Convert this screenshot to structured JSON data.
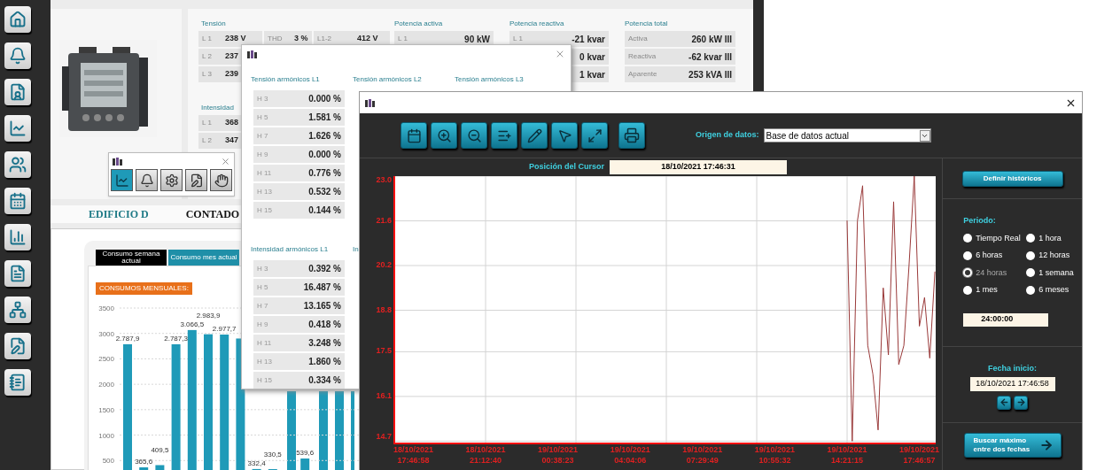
{
  "meter_panel": {
    "tension": {
      "title": "Tensión",
      "rows": [
        [
          {
            "label": "L 1",
            "value": "238 V"
          },
          {
            "label": "THD",
            "value": "3 %"
          },
          {
            "label": "L1-2",
            "value": "412 V"
          }
        ],
        [
          {
            "label": "L 2",
            "value": "237"
          }
        ],
        [
          {
            "label": "L 3",
            "value": "239"
          }
        ]
      ]
    },
    "intensidad": {
      "title": "Intensidad",
      "rows": [
        {
          "label": "L 1",
          "value": "368"
        },
        {
          "label": "L 2",
          "value": "347"
        }
      ]
    },
    "potencia_activa": {
      "title": "Potencia activa",
      "rows": [
        {
          "label": "L 1",
          "value": "90 kW"
        }
      ]
    },
    "potencia_reactiva": {
      "title": "Potencia reactiva",
      "rows": [
        {
          "label": "L 1",
          "value": "-21 kvar"
        },
        {
          "value": "0 kvar"
        },
        {
          "value": "1 kvar"
        }
      ]
    },
    "potencia_total": {
      "title": "Potencia total",
      "rows": [
        {
          "label": "Activa",
          "value": "260 kW III"
        },
        {
          "label": "Reactiva",
          "value": "-62 kvar III"
        },
        {
          "label": "Aparente",
          "value": "253 kVA III"
        }
      ]
    }
  },
  "tool_window": {
    "buttons": [
      {
        "selected": true
      },
      {
        "selected": false
      },
      {
        "selected": false
      },
      {
        "selected": false
      },
      {
        "selected": false
      }
    ]
  },
  "building_bar": {
    "building": "EDIFICIO D",
    "meter": "CONTADO"
  },
  "consumption_card": {
    "tabs": [
      {
        "label": "Consumo semana actual",
        "selected": false
      },
      {
        "label": "Consumo mes actual",
        "selected": true
      }
    ],
    "label": "CONSUMOS MENSUALES:",
    "chart_data": {
      "type": "bar",
      "grid": true,
      "ylim": [
        0,
        3500
      ],
      "yticks": [
        500,
        1000,
        1500,
        2000,
        2500,
        3000,
        3500
      ],
      "values": [
        2787.9,
        365.6,
        409.5,
        2787.3,
        3066.5,
        2983.9,
        2977.7,
        2900,
        332.4,
        330.5,
        null,
        539.6,
        null,
        null,
        null
      ],
      "value_labels": [
        "2.787,9",
        "365,6",
        "409,5",
        "2.787,3",
        "3.066,5",
        "2.983,9",
        "2.977,7",
        null,
        "332,4",
        "330,5",
        null,
        "539,6",
        null,
        null,
        null
      ]
    }
  },
  "harmonics_window": {
    "sections": [
      {
        "columns": [
          {
            "title": "Tensión armónicos L1",
            "rows": [
              {
                "label": "H 3",
                "value": "0.000 %"
              },
              {
                "label": "H 5",
                "value": "1.581 %"
              },
              {
                "label": "H 7",
                "value": "1.626 %"
              },
              {
                "label": "H 9",
                "value": "0.000 %"
              },
              {
                "label": "H 11",
                "value": "0.776 %"
              },
              {
                "label": "H 13",
                "value": "0.532 %"
              },
              {
                "label": "H 15",
                "value": "0.144 %"
              }
            ]
          },
          {
            "title": "Tensión armónicos L2"
          },
          {
            "title": "Tensión armónicos L3"
          }
        ]
      },
      {
        "columns": [
          {
            "title": "Intensidad armónicos L1",
            "rows": [
              {
                "label": "H 3",
                "value": "0.392 %"
              },
              {
                "label": "H 5",
                "value": "16.487 %"
              },
              {
                "label": "H 7",
                "value": "13.165 %"
              },
              {
                "label": "H 9",
                "value": "0.418 %"
              },
              {
                "label": "H 11",
                "value": "3.248 %"
              },
              {
                "label": "H 13",
                "value": "1.860 %"
              },
              {
                "label": "H 15",
                "value": "0.334 %"
              }
            ]
          },
          {
            "title": "In"
          }
        ]
      }
    ]
  },
  "chart_window": {
    "source": {
      "label": "Origen de datos:",
      "value": "Base de datos actual"
    },
    "cursor": {
      "label": "Posición del Cursor",
      "value": "18/10/2021 17:46:31"
    },
    "chart_data": {
      "type": "line",
      "grid": true,
      "ylim": [
        14.6,
        23.0
      ],
      "yticks": [
        {
          "value": 14.7,
          "label": "14.7"
        },
        {
          "value": 16.1,
          "label": "16.1"
        },
        {
          "value": 17.5,
          "label": "17.5"
        },
        {
          "value": 18.8,
          "label": "18.8"
        },
        {
          "value": 20.2,
          "label": "20.2"
        },
        {
          "value": 21.6,
          "label": "21.6"
        },
        {
          "value": 23.0,
          "label": "23.0"
        }
      ],
      "categories": [
        "18/10/2021 17:46:58",
        null,
        null,
        null,
        null,
        null,
        null,
        null,
        null,
        null,
        null,
        null,
        null,
        null,
        "18/10/2021 21:12:40",
        null,
        null,
        null,
        null,
        null,
        null,
        null,
        null,
        null,
        null,
        null,
        null,
        null,
        "19/10/2021 00:38:23",
        null,
        null,
        null,
        null,
        null,
        null,
        null,
        null,
        null,
        null,
        null,
        null,
        null,
        "19/10/2021 04:04:06",
        null,
        null,
        null,
        null,
        null,
        null,
        null,
        null,
        null,
        null,
        null,
        null,
        null,
        "19/10/2021 07:29:49",
        null,
        null,
        null,
        null,
        null,
        null,
        null,
        null,
        null,
        null,
        null,
        null,
        null,
        "19/10/2021 10:55:32",
        null,
        null,
        null,
        null,
        null,
        null,
        null,
        null,
        null,
        null,
        null,
        null,
        null,
        "19/10/2021 14:21:15",
        null,
        null,
        null,
        null,
        null,
        null,
        null,
        null,
        null,
        null,
        null,
        null,
        null,
        "19/10/2021 17:46:57",
        null,
        null,
        null
      ],
      "series": [
        {
          "color": "#9a3a3a",
          "values": [
            null,
            null,
            null,
            null,
            null,
            null,
            null,
            null,
            null,
            null,
            null,
            null,
            null,
            null,
            null,
            null,
            null,
            null,
            null,
            null,
            null,
            null,
            null,
            null,
            null,
            null,
            null,
            null,
            null,
            null,
            null,
            null,
            null,
            null,
            null,
            null,
            null,
            null,
            null,
            null,
            null,
            null,
            null,
            null,
            null,
            null,
            null,
            null,
            null,
            null,
            null,
            null,
            null,
            null,
            null,
            null,
            null,
            null,
            null,
            null,
            null,
            null,
            null,
            null,
            null,
            null,
            null,
            null,
            null,
            null,
            null,
            null,
            null,
            null,
            null,
            null,
            null,
            null,
            null,
            null,
            null,
            null,
            null,
            null,
            21.6,
            14.7,
            21.6,
            22.7,
            17.7,
            16.8,
            15.05,
            19.5,
            17.4,
            22.2,
            17.1,
            17.7,
            20.2,
            23.0,
            18.3,
            19.2,
            17.3,
            20.0
          ]
        }
      ]
    },
    "define_button": "Definir históricos",
    "period": {
      "label": "Periodo:",
      "options": [
        {
          "label": "Tiempo Real",
          "selected": false
        },
        {
          "label": "1 hora",
          "selected": false
        },
        {
          "label": "6 horas",
          "selected": false
        },
        {
          "label": "12 horas",
          "selected": false
        },
        {
          "label": "24 horas",
          "selected": true
        },
        {
          "label": "1 semana",
          "selected": false
        },
        {
          "label": "1 mes",
          "selected": false
        },
        {
          "label": "6 meses",
          "selected": false
        }
      ],
      "duration": "24:00:00"
    },
    "start_date": {
      "label": "Fecha inicio:",
      "value": "18/10/2021 17:46:58"
    },
    "search_button": "Buscar máximo entre dos fechas"
  }
}
